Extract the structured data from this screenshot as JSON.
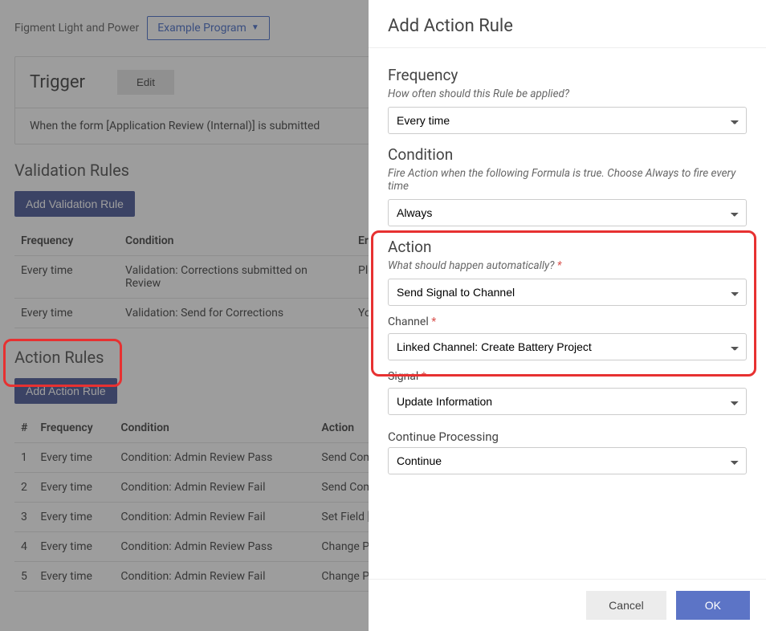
{
  "breadcrumb": {
    "org": "Figment Light and Power",
    "program": "Example Program"
  },
  "trigger": {
    "title": "Trigger",
    "edit_label": "Edit",
    "description": "When the form [Application Review (Internal)] is submitted"
  },
  "validation": {
    "heading": "Validation Rules",
    "add_label": "Add Validation Rule",
    "cols": {
      "frequency": "Frequency",
      "condition": "Condition",
      "error": "Er"
    },
    "rows": [
      {
        "freq": "Every time",
        "cond": "Validation: Corrections submitted on Review",
        "err": "Ple"
      },
      {
        "freq": "Every time",
        "cond": "Validation: Send for Corrections",
        "err": "Yo co"
      }
    ]
  },
  "actions": {
    "heading": "Action Rules",
    "add_label": "Add Action Rule",
    "cols": {
      "num": "#",
      "frequency": "Frequency",
      "condition": "Condition",
      "action": "Action"
    },
    "rows": [
      {
        "n": "1",
        "freq": "Every time",
        "cond": "Condition: Admin Review Pass",
        "act": "Send Commu Application Pa"
      },
      {
        "n": "2",
        "freq": "Every time",
        "cond": "Condition: Admin Review Fail",
        "act": "Send Commu Corrections Re"
      },
      {
        "n": "3",
        "freq": "Every time",
        "cond": "Condition: Admin Review Fail",
        "act": "Set Field [Cor"
      },
      {
        "n": "4",
        "freq": "Every time",
        "cond": "Condition: Admin Review Pass",
        "act": "Change Proje Agreement Ex"
      },
      {
        "n": "5",
        "freq": "Every time",
        "cond": "Condition: Admin Review Fail",
        "act": "Change Proje"
      }
    ]
  },
  "modal": {
    "title": "Add Action Rule",
    "frequency": {
      "heading": "Frequency",
      "hint": "How often should this Rule be applied?",
      "value": "Every time"
    },
    "condition": {
      "heading": "Condition",
      "hint": "Fire Action when the following Formula is true. Choose Always to fire every time",
      "value": "Always"
    },
    "action": {
      "heading": "Action",
      "hint": "What should happen automatically?",
      "action_value": "Send Signal to Channel",
      "channel_label": "Channel",
      "channel_value": "Linked Channel: Create Battery Project",
      "signal_label": "Signal",
      "signal_value": "Update Information"
    },
    "continue": {
      "heading": "Continue Processing",
      "value": "Continue"
    },
    "buttons": {
      "cancel": "Cancel",
      "ok": "OK"
    }
  }
}
